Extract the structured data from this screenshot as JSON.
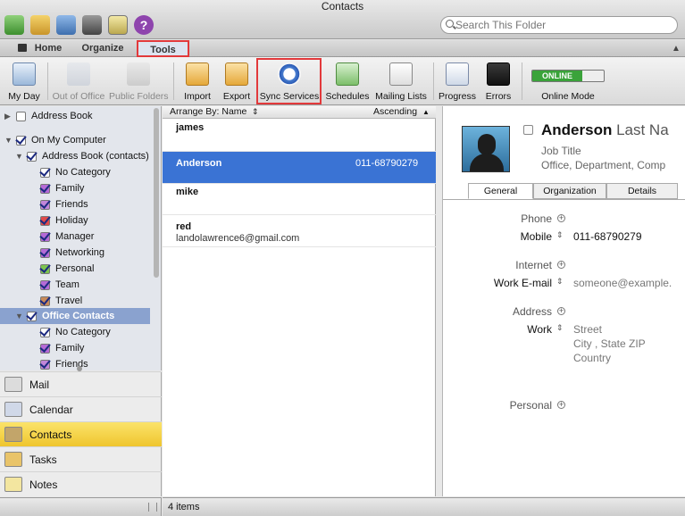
{
  "window": {
    "title": "Contacts"
  },
  "search": {
    "placeholder": "Search This Folder"
  },
  "tabs": [
    "Home",
    "Organize",
    "Tools"
  ],
  "ribbon": [
    {
      "label": "My Day",
      "icon": "calendar-day-icon",
      "enabled": true
    },
    {
      "label": "Out of Office",
      "icon": "out-of-office-icon",
      "enabled": false
    },
    {
      "label": "Public Folders",
      "icon": "public-folders-icon",
      "enabled": false
    },
    {
      "label": "Import",
      "icon": "import-icon",
      "enabled": true
    },
    {
      "label": "Export",
      "icon": "export-icon",
      "enabled": true
    },
    {
      "label": "Sync Services",
      "icon": "sync-icon",
      "enabled": true
    },
    {
      "label": "Schedules",
      "icon": "schedules-icon",
      "enabled": true
    },
    {
      "label": "Mailing Lists",
      "icon": "mailing-lists-icon",
      "enabled": true
    },
    {
      "label": "Progress",
      "icon": "progress-icon",
      "enabled": true
    },
    {
      "label": "Errors",
      "icon": "errors-icon",
      "enabled": true
    },
    {
      "label": "Online Mode",
      "icon": "online-toggle",
      "enabled": true
    }
  ],
  "online_badge": "ONLINE",
  "folders": [
    {
      "label": "Address Book",
      "checked": false,
      "color": "#ffffff"
    },
    {
      "label": "On My Computer",
      "checked": true,
      "color": "#ffffff"
    },
    {
      "label": "Address Book (contacts)",
      "checked": true,
      "color": "#ffffff"
    },
    {
      "label": "No Category",
      "checked": true,
      "color": "#ffffff"
    },
    {
      "label": "Family",
      "checked": true,
      "color": "#b56ad6"
    },
    {
      "label": "Friends",
      "checked": true,
      "color": "#c386d9"
    },
    {
      "label": "Holiday",
      "checked": true,
      "color": "#e04a4a"
    },
    {
      "label": "Manager",
      "checked": true,
      "color": "#b56ad6"
    },
    {
      "label": "Networking",
      "checked": true,
      "color": "#b56ad6"
    },
    {
      "label": "Personal",
      "checked": true,
      "color": "#7cc44f"
    },
    {
      "label": "Team",
      "checked": true,
      "color": "#b56ad6"
    },
    {
      "label": "Travel",
      "checked": true,
      "color": "#c88a5a"
    },
    {
      "label": "Office Contacts",
      "checked": true,
      "color": "#ffffff"
    },
    {
      "label": "No Category",
      "checked": true,
      "color": "#ffffff"
    },
    {
      "label": "Family",
      "checked": true,
      "color": "#b56ad6"
    },
    {
      "label": "Friends",
      "checked": true,
      "color": "#c386d9"
    }
  ],
  "nav": [
    {
      "label": "Mail",
      "icon": "mail-icon"
    },
    {
      "label": "Calendar",
      "icon": "calendar-icon"
    },
    {
      "label": "Contacts",
      "icon": "contacts-icon",
      "selected": true
    },
    {
      "label": "Tasks",
      "icon": "tasks-icon"
    },
    {
      "label": "Notes",
      "icon": "notes-icon"
    }
  ],
  "list": {
    "arrange": "Arrange By: Name",
    "order": "Ascending",
    "items": [
      {
        "name": "james",
        "phone": "",
        "email": ""
      },
      {
        "name": "Anderson",
        "phone": "011-68790279",
        "email": "",
        "selected": true
      },
      {
        "name": "mike",
        "phone": "",
        "email": ""
      },
      {
        "name": "red",
        "phone": "",
        "email": "landolawrence6@gmail.com"
      }
    ]
  },
  "detail": {
    "first": "Anderson",
    "last": "Last Na",
    "job_title": "Job Title",
    "office": "Office,",
    "department": "Department,",
    "company": "Comp",
    "tabs": [
      "General",
      "Organization",
      "Details"
    ],
    "phone_label": "Phone",
    "mobile_label": "Mobile",
    "mobile_value": "011-68790279",
    "internet_label": "Internet",
    "work_email_label": "Work E-mail",
    "work_email_value": "someone@example.",
    "address_label": "Address",
    "work_label": "Work",
    "street": "Street",
    "city_line": "City , State ZIP",
    "country": "Country",
    "personal_label": "Personal"
  },
  "status": {
    "items": "4 items"
  },
  "colors": {
    "accent": "#3a73d4",
    "highlight": "#e2393b",
    "selected_nav": "#f2cb3a",
    "online": "#3aa33a"
  }
}
